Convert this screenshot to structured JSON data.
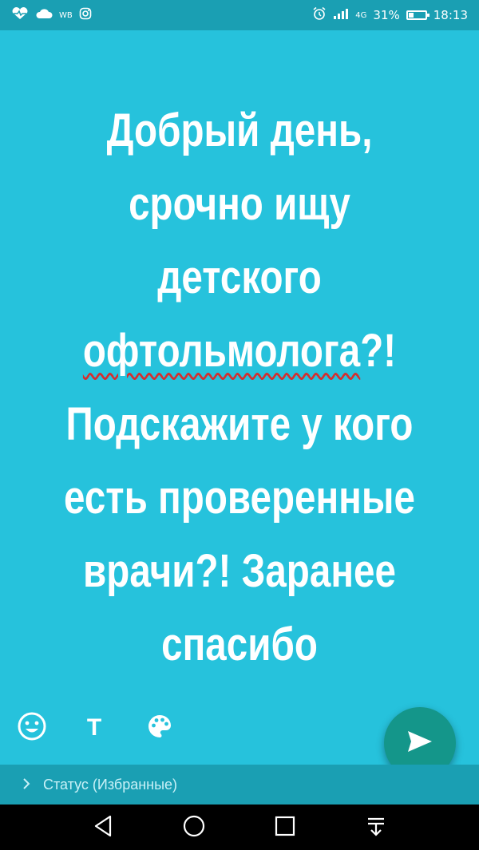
{
  "status_bar": {
    "carrier_label": "WB",
    "battery": "31%",
    "battery_level": 0.31,
    "time": "18:13",
    "network_label": "4G"
  },
  "status_message": {
    "line1": "Добрый день,",
    "line2": "срочно ищу",
    "line3": "детского",
    "misspelled_word": "офтольмолога",
    "line4_suffix": "?!",
    "line5": "Подскажите у кого",
    "line6": "есть проверенные",
    "line7": "врачи?! Заранее",
    "line8": "спасибо"
  },
  "toolbar": {
    "text_tool_label": "T"
  },
  "caption": {
    "text": "Статус (Избранные)"
  },
  "colors": {
    "background": "#26c2dc",
    "bar": "#1a9fb3",
    "send_button": "#14968a"
  },
  "icons": [
    "heart-pulse-icon",
    "cloud-icon",
    "instagram-icon",
    "alarm-icon",
    "signal-icon",
    "battery-icon",
    "emoji-icon",
    "text-icon",
    "palette-icon",
    "send-icon",
    "chevron-right-icon",
    "back-icon",
    "home-icon",
    "recents-icon",
    "notifications-icon"
  ]
}
